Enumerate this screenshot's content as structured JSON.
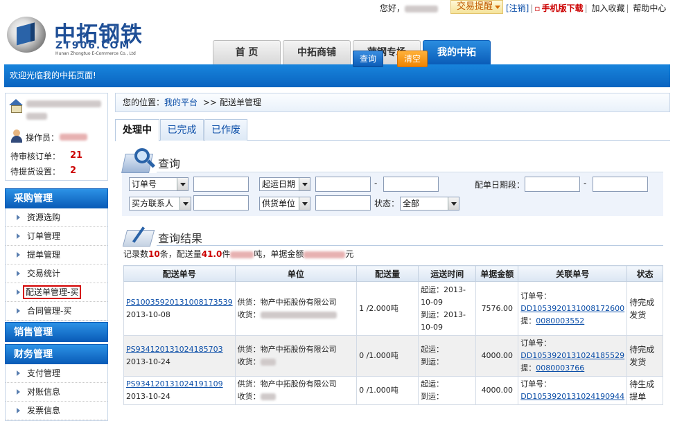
{
  "topbar": {
    "greeting": "您好，",
    "trade_alert": "交易提醒",
    "logout": "[注销]",
    "mobile": "手机版下载",
    "favorite": "加入收藏",
    "help": "帮助中心"
  },
  "logo": {
    "title": "中拓钢铁",
    "domain": "ZT906.COM",
    "english": "Hunan Zhongtuo E-Commerce Co., Ltd"
  },
  "nav": {
    "tabs": [
      "首 页",
      "中拓商铺",
      "萍钢专场",
      "我的中拓"
    ],
    "active_index": 3
  },
  "welcome": "欢迎光临我的中拓页面!",
  "userbox": {
    "operator_label": "操作员：",
    "pending_review_label": "待审核订单：",
    "pending_review_count": "21",
    "pending_pickup_label": "待提货设置：",
    "pending_pickup_count": "2"
  },
  "menus": {
    "purchase": {
      "title": "采购管理",
      "items": [
        "资源选购",
        "订单管理",
        "提单管理",
        "交易统计",
        "配送单管理-买",
        "合同管理-买"
      ]
    },
    "sales": {
      "title": "销售管理"
    },
    "finance": {
      "title": "财务管理",
      "items": [
        "支付管理",
        "对账信息",
        "发票信息"
      ]
    }
  },
  "breadcrumb": {
    "prefix": "您的位置：",
    "link": "我的平台",
    "sep": ">>",
    "current": "配送单管理"
  },
  "subtabs": [
    "处理中",
    "已完成",
    "已作废"
  ],
  "query": {
    "title": "查询",
    "select_order": "订单号",
    "select_date": "起运日期",
    "date_sep": "-",
    "date_range_label": "配单日期段：",
    "date_range_sep": "-",
    "select_contact": "买方联系人",
    "select_supplier": "供货单位",
    "status_label": "状态：",
    "status_value": "全部",
    "search_button": "查询",
    "clear_button": "清空"
  },
  "results": {
    "title": "查询结果",
    "summary_prefix": "记录数",
    "record_count": "10",
    "summary_mid1": "条，配送量",
    "quantity": "41.0",
    "summary_mid2": "件",
    "summary_mid3": "吨，单据金额",
    "summary_end": "元",
    "columns": [
      "配送单号",
      "单位",
      "配送量",
      "运送时间",
      "单据金额",
      "关联单号",
      "状态"
    ],
    "rows": [
      {
        "no": "PS10035920131008173539",
        "date": "2013-10-08",
        "supplier": "供货：物产中拓股份有限公司",
        "receiver_label": "收货：",
        "qty": "1 /2.000吨",
        "ship_start": "起运：2013-10-09",
        "ship_end": "到运：2013-10-09",
        "amount": "7576.00",
        "order_label": "订单号：",
        "order_no": "DD1053920131008172600",
        "pickup_label": "提：",
        "pickup_no": "0080003552",
        "status": "待完成发货"
      },
      {
        "no": "PS934120131024185703",
        "date": "2013-10-24",
        "supplier": "供货：物产中拓股份有限公司",
        "receiver_label": "收货：",
        "qty": "0 /1.000吨",
        "ship_start": "起运：",
        "ship_end": "到运：",
        "amount": "4000.00",
        "order_label": "订单号：",
        "order_no": "DD1053920131024185529",
        "pickup_label": "提：",
        "pickup_no": "0080003766",
        "status": "待完成发货"
      },
      {
        "no": "PS934120131024191109",
        "date": "2013-10-24",
        "supplier": "供货：物产中拓股份有限公司",
        "receiver_label": "收货：",
        "qty": "0 /1.000吨",
        "ship_start": "起运：",
        "ship_end": "到运：",
        "amount": "4000.00",
        "order_label": "订单号：",
        "order_no": "DD1053920131024190944",
        "pickup_label": "",
        "pickup_no": "",
        "status": "待生成提单"
      }
    ]
  },
  "colors": {
    "brand_blue": "#0a64c0",
    "highlight_red": "#d40000",
    "count_red": "#cc0000",
    "clear_orange": "#f08400"
  }
}
